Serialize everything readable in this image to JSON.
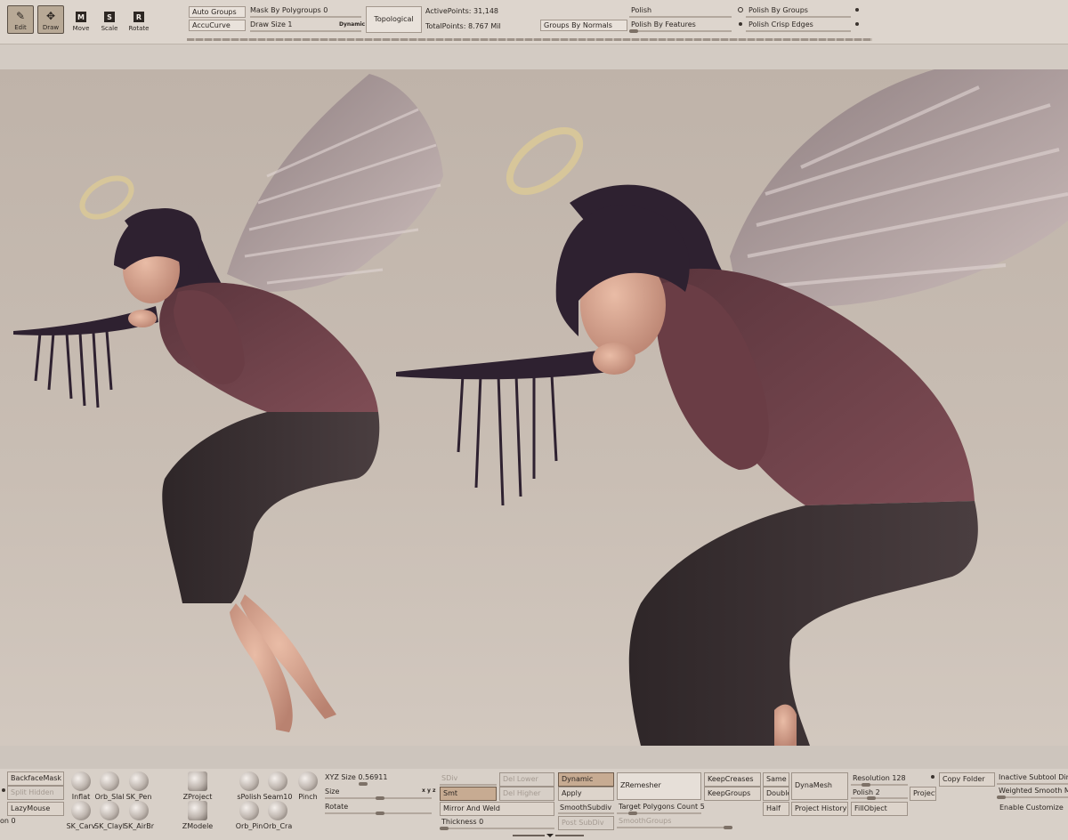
{
  "top_toolbar": {
    "modes": [
      {
        "label": "Edit",
        "icon": "edit-icon"
      },
      {
        "label": "Draw",
        "icon": "draw-icon"
      }
    ],
    "tools": [
      {
        "label": "Move",
        "key": "M"
      },
      {
        "label": "Scale",
        "key": "S"
      },
      {
        "label": "Rotate",
        "key": "R"
      }
    ],
    "auto_groups": "Auto Groups",
    "accucurve": "AccuCurve",
    "mask_by_polygroups": "Mask By Polygroups 0",
    "draw_size": "Draw Size 1",
    "dynamic": "Dynamic",
    "topological": "Topological",
    "active_points": "ActivePoints: 31,148",
    "total_points": "TotalPoints: 8.767 Mil",
    "groups_by_normals": "Groups By Normals",
    "polish": "Polish",
    "polish_by_features": "Polish By Features",
    "polish_by_groups": "Polish By Groups",
    "polish_crisp_edges": "Polish Crisp Edges"
  },
  "bottom_toolbar": {
    "backface_mask": "BackfaceMask",
    "split_hidden": "Split Hidden",
    "lazy_mouse": "LazyMouse",
    "left_cut_value": "on 0",
    "brushes": [
      {
        "label": "Inflat"
      },
      {
        "label": "Orb_Slal"
      },
      {
        "label": "SK_Pen"
      },
      {
        "label": "SK_Carv"
      },
      {
        "label": "SK_Clayl"
      },
      {
        "label": "SK_AirBr"
      },
      {
        "label": "ZProject"
      },
      {
        "label": "ZModele"
      },
      {
        "label": "sPolish"
      },
      {
        "label": "Seam10"
      },
      {
        "label": "Pinch"
      },
      {
        "label": "Orb_Pin"
      },
      {
        "label": "Orb_Cra"
      }
    ],
    "xyz_size": "XYZ Size 0.56911",
    "size": "Size",
    "rotate": "Rotate",
    "xyz_marker": "x y z",
    "sdiv": "SDiv",
    "smt": "Smt",
    "del_lower": "Del Lower",
    "del_higher": "Del Higher",
    "dynamic": "Dynamic",
    "apply": "Apply",
    "mirror_and_weld": "Mirror And Weld",
    "smooth_subdiv": "SmoothSubdiv",
    "post_subdiv": "Post SubDiv",
    "thickness": "Thickness 0",
    "zremesher": "ZRemesher",
    "target_polygons": "Target Polygons Count 5",
    "smooth_groups": "SmoothGroups",
    "keep_creases": "KeepCreases",
    "keep_groups": "KeepGroups",
    "same": "Same",
    "double": "Double",
    "half": "Half",
    "dynamesh": "DynaMesh",
    "project_history": "Project History",
    "resolution": "Resolution 128",
    "polish_2": "Polish 2",
    "fill_object": "FillObject",
    "project": "Project",
    "copy_folder": "Copy Folder",
    "inactive_subtool": "Inactive Subtool Dim",
    "weighted_smooth": "Weighted Smooth M",
    "enable_customize": "Enable Customize"
  },
  "colors": {
    "shelf_bg": "#ddd5cd",
    "viewport_bg": "#c5bab0",
    "highlight": "#c7ab92",
    "shirt": "#6e4148",
    "skirt": "#3a2f31",
    "hair": "#2e2130",
    "skin": "#d9a690",
    "wings": "#b7a7a6",
    "halo": "#d8c79e"
  }
}
